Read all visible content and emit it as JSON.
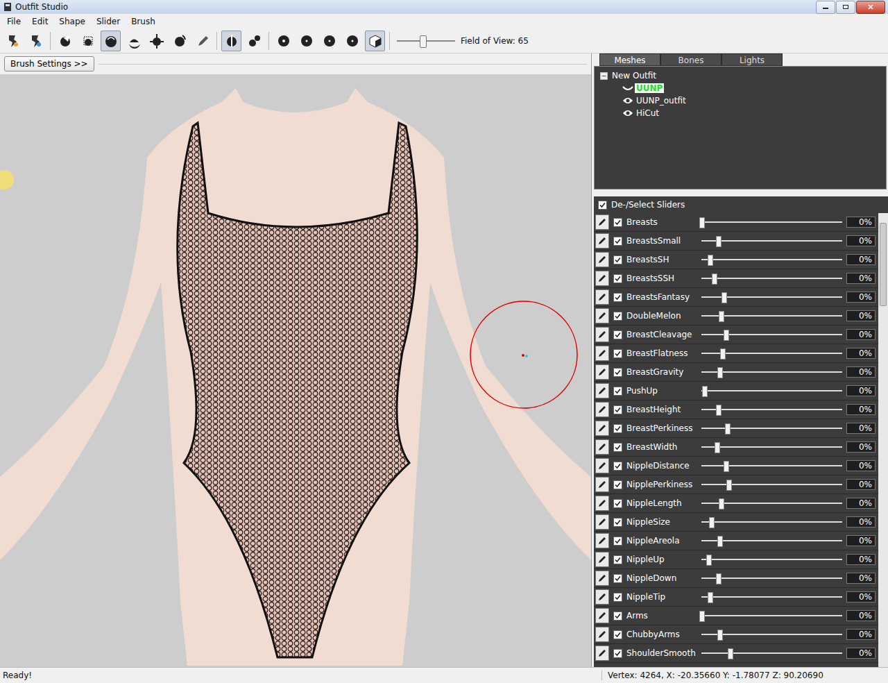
{
  "window": {
    "title": "Outfit Studio"
  },
  "menu": [
    "File",
    "Edit",
    "Shape",
    "Slider",
    "Brush"
  ],
  "toolbar": {
    "groups": [
      [
        {
          "selected": false
        },
        {
          "selected": false
        }
      ],
      [
        {
          "selected": false
        },
        {
          "selected": false
        },
        {
          "selected": true
        },
        {
          "selected": false
        },
        {
          "selected": false
        },
        {
          "selected": false
        },
        {
          "selected": false
        }
      ],
      [
        {
          "selected": true
        },
        {
          "selected": false
        }
      ],
      [
        {
          "selected": false
        },
        {
          "selected": false
        },
        {
          "selected": false
        },
        {
          "selected": false
        },
        {
          "selected": true
        }
      ]
    ],
    "fov": {
      "level": 0.44,
      "label": "Field of View: 65"
    }
  },
  "brush_settings": {
    "label": "Brush Settings >>"
  },
  "tabs": [
    {
      "label": "Meshes",
      "selected": true
    },
    {
      "label": "Bones",
      "selected": false
    },
    {
      "label": "Lights",
      "selected": false
    }
  ],
  "tree": {
    "root": {
      "label": "New Outfit",
      "expander": "−",
      "expanded": true
    },
    "items": [
      {
        "label": "UUNP",
        "selected": true,
        "visible": false
      },
      {
        "label": "UUNP_outfit",
        "selected": false,
        "visible": true
      },
      {
        "label": "HiCut",
        "selected": false,
        "visible": true
      }
    ]
  },
  "sliders_header": {
    "label": "De-/Select Sliders",
    "checked": true
  },
  "sliders": [
    {
      "name": "Breasts",
      "checked": true,
      "level": 0.0,
      "value": "0%"
    },
    {
      "name": "BreastsSmall",
      "checked": true,
      "level": 0.12,
      "value": "0%"
    },
    {
      "name": "BreastsSH",
      "checked": true,
      "level": 0.06,
      "value": "0%"
    },
    {
      "name": "BreastsSSH",
      "checked": true,
      "level": 0.09,
      "value": "0%"
    },
    {
      "name": "BreastsFantasy",
      "checked": true,
      "level": 0.16,
      "value": "0%"
    },
    {
      "name": "DoubleMelon",
      "checked": true,
      "level": 0.14,
      "value": "0%"
    },
    {
      "name": "BreastCleavage",
      "checked": true,
      "level": 0.17,
      "value": "0%"
    },
    {
      "name": "BreastFlatness",
      "checked": true,
      "level": 0.15,
      "value": "0%"
    },
    {
      "name": "BreastGravity",
      "checked": true,
      "level": 0.13,
      "value": "0%"
    },
    {
      "name": "PushUp",
      "checked": true,
      "level": 0.02,
      "value": "0%"
    },
    {
      "name": "BreastHeight",
      "checked": true,
      "level": 0.12,
      "value": "0%"
    },
    {
      "name": "BreastPerkiness",
      "checked": true,
      "level": 0.18,
      "value": "0%"
    },
    {
      "name": "BreastWidth",
      "checked": true,
      "level": 0.11,
      "value": "0%"
    },
    {
      "name": "NippleDistance",
      "checked": true,
      "level": 0.17,
      "value": "0%"
    },
    {
      "name": "NipplePerkiness",
      "checked": true,
      "level": 0.19,
      "value": "0%"
    },
    {
      "name": "NippleLength",
      "checked": true,
      "level": 0.14,
      "value": "0%"
    },
    {
      "name": "NippleSize",
      "checked": true,
      "level": 0.07,
      "value": "0%"
    },
    {
      "name": "NippleAreola",
      "checked": true,
      "level": 0.13,
      "value": "0%"
    },
    {
      "name": "NippleUp",
      "checked": true,
      "level": 0.05,
      "value": "0%"
    },
    {
      "name": "NippleDown",
      "checked": true,
      "level": 0.12,
      "value": "0%"
    },
    {
      "name": "NippleTip",
      "checked": true,
      "level": 0.06,
      "value": "0%"
    },
    {
      "name": "Arms",
      "checked": true,
      "level": 0.0,
      "value": "0%"
    },
    {
      "name": "ChubbyArms",
      "checked": true,
      "level": 0.13,
      "value": "0%"
    },
    {
      "name": "ShoulderSmooth",
      "checked": true,
      "level": 0.2,
      "value": "0%"
    }
  ],
  "status_bar": {
    "left": "Ready!",
    "right": "Vertex: 4264, X: -20.35660 Y: -1.78077 Z: 90.20690"
  }
}
